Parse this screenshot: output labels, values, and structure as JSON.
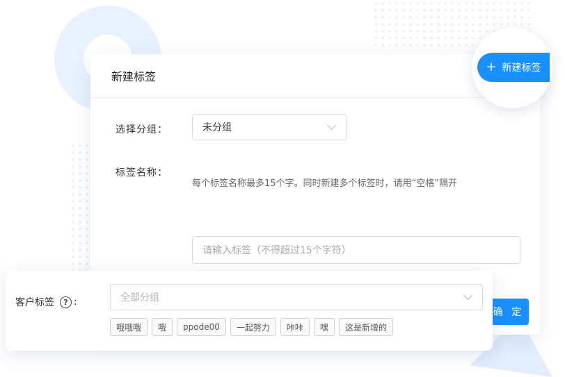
{
  "dialog": {
    "title": "新建标签",
    "group_label": "选择分组：",
    "group_value": "未分组",
    "name_label": "标签名称：",
    "hint": "每个标签名称最多15个字。同时新建多个标签时，请用“空格”隔开",
    "name_placeholder": "请输入标签（不得超过15个字符）",
    "confirm_label": "确 定"
  },
  "new_tag_button": {
    "label": "新建标签"
  },
  "customer_tags": {
    "label": "客户标签",
    "help": "?",
    "colon": ":",
    "group_placeholder": "全部分组",
    "tags": [
      "哦哦哦",
      "哦",
      "ppode00",
      "一起努力",
      "咔咔",
      "嘿",
      "这是新增的"
    ]
  },
  "colors": {
    "primary": "#1890ff"
  }
}
